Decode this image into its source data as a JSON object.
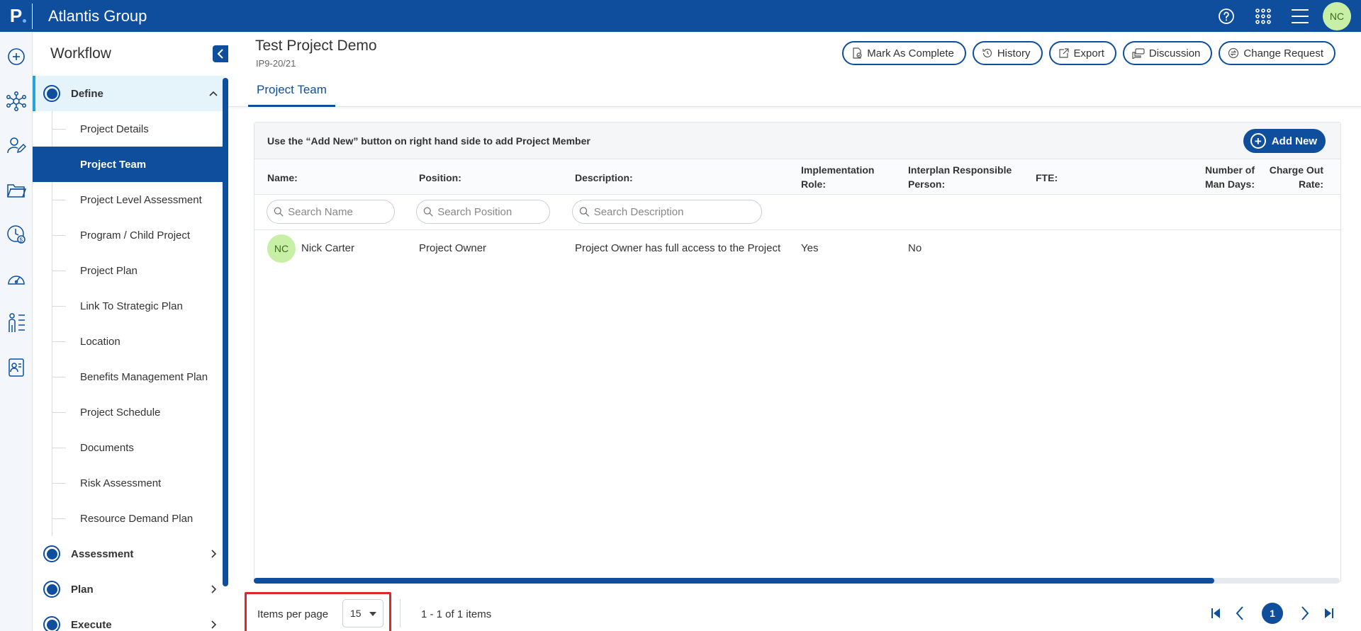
{
  "topbar": {
    "logo_letter": "P",
    "app_title": "Atlantis Group",
    "icons": [
      "help-icon",
      "apps-grid-icon",
      "menu-icon"
    ],
    "user_initials": "NC"
  },
  "rail": {
    "icons": [
      "add-circle-icon",
      "network-icon",
      "user-edit-icon",
      "folder-icon",
      "clock-dollar-icon",
      "dashboard-gauge-icon",
      "org-chart-icon",
      "contact-card-icon"
    ]
  },
  "sidebar": {
    "title": "Workflow",
    "sections": [
      {
        "label": "Define",
        "expanded": true,
        "items": [
          {
            "label": "Project Details"
          },
          {
            "label": "Project Team",
            "active": true
          },
          {
            "label": "Project Level Assessment"
          },
          {
            "label": "Program / Child Project"
          },
          {
            "label": "Project Plan"
          },
          {
            "label": "Link To Strategic Plan"
          },
          {
            "label": "Location"
          },
          {
            "label": "Benefits Management Plan"
          },
          {
            "label": "Project Schedule"
          },
          {
            "label": "Documents"
          },
          {
            "label": "Risk Assessment"
          },
          {
            "label": "Resource Demand Plan"
          }
        ]
      },
      {
        "label": "Assessment",
        "expanded": false
      },
      {
        "label": "Plan",
        "expanded": false
      },
      {
        "label": "Execute",
        "expanded": false
      }
    ]
  },
  "project": {
    "title": "Test Project Demo",
    "code": "IP9-20/21"
  },
  "actions": [
    {
      "label": "Mark As Complete",
      "icon": "document-check-icon"
    },
    {
      "label": "History",
      "icon": "history-icon"
    },
    {
      "label": "Export",
      "icon": "export-icon"
    },
    {
      "label": "Discussion",
      "icon": "discussion-icon"
    },
    {
      "label": "Change Request",
      "icon": "change-request-icon"
    }
  ],
  "tab": {
    "label": "Project Team"
  },
  "panel": {
    "instruction": "Use the “Add New” button on right hand side to add Project Member",
    "add_new_label": "Add New"
  },
  "table": {
    "columns": {
      "name": "Name:",
      "position": "Position:",
      "description": "Description:",
      "implementation_role_1": "Implementation",
      "implementation_role_2": "Role:",
      "responsible_1": "Interplan Responsible",
      "responsible_2": "Person:",
      "fte": "FTE:",
      "man_days_1": "Number of",
      "man_days_2": "Man Days:",
      "charge_1": "Charge Out",
      "charge_2": "Rate:"
    },
    "filters": {
      "name_placeholder": "Search Name",
      "position_placeholder": "Search Position",
      "description_placeholder": "Search Description"
    },
    "rows": [
      {
        "initials": "NC",
        "name": "Nick Carter",
        "position": "Project Owner",
        "description": "Project Owner has full access to the Project",
        "implementation_role": "Yes",
        "responsible_person": "No",
        "fte": "",
        "man_days": "",
        "charge_out_rate": ""
      }
    ]
  },
  "pager": {
    "items_per_page_label": "Items per page",
    "items_per_page_value": "15",
    "info": "1 - 1 of 1 items",
    "current_page": "1"
  },
  "colors": {
    "brand": "#0e4e9c",
    "active_section_bg": "#e5f3fa",
    "avatar_bg": "#c7f0a6",
    "highlight_box": "#e0262b"
  }
}
